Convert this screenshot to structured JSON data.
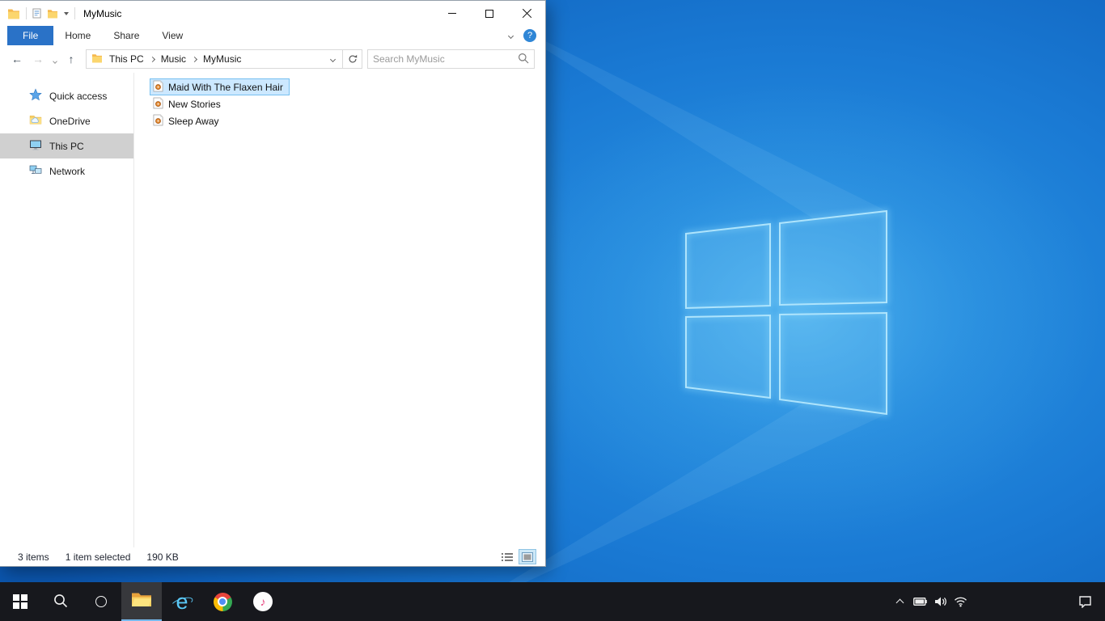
{
  "window": {
    "title": "MyMusic",
    "ribbon": {
      "tabs": [
        {
          "label": "File",
          "active": true
        },
        {
          "label": "Home",
          "active": false
        },
        {
          "label": "Share",
          "active": false
        },
        {
          "label": "View",
          "active": false
        }
      ],
      "help_label": "?"
    },
    "navigation": {
      "breadcrumb": [
        "This PC",
        "Music",
        "MyMusic"
      ],
      "search_placeholder": "Search MyMusic"
    },
    "sidebar": {
      "items": [
        {
          "label": "Quick access",
          "icon": "star-icon",
          "selected": false
        },
        {
          "label": "OneDrive",
          "icon": "onedrive-folder-icon",
          "selected": false
        },
        {
          "label": "This PC",
          "icon": "computer-icon",
          "selected": true
        },
        {
          "label": "Network",
          "icon": "network-icon",
          "selected": false
        }
      ]
    },
    "files": {
      "items": [
        {
          "name": "Maid With The Flaxen Hair",
          "icon": "music-file-icon",
          "selected": true
        },
        {
          "name": "New Stories",
          "icon": "music-file-icon",
          "selected": false
        },
        {
          "name": "Sleep Away",
          "icon": "music-file-icon",
          "selected": false
        }
      ]
    },
    "status": {
      "count": "3 items",
      "selection": "1 item selected",
      "size": "190 KB"
    }
  },
  "icons": {
    "back_arrow": "←",
    "forward_arrow": "→",
    "up_arrow": "↑"
  },
  "taskbar": {
    "buttons": [
      "start",
      "search",
      "cortana",
      "file-explorer",
      "internet-explorer",
      "chrome",
      "itunes"
    ],
    "active_app": "file-explorer",
    "ie_glyph": "e",
    "itunes_glyph": "♪",
    "tray": [
      "hidden-icons",
      "battery",
      "volume",
      "network",
      "action-center"
    ]
  },
  "colors": {
    "file_tab_blue": "#2a72c7",
    "selection_bg": "#cce8ff",
    "selection_border": "#77c0f0",
    "sidebar_selected_bg": "#d0d0d0",
    "desktop_blue": "#1a7ad4",
    "taskbar_bg": "#17181d"
  }
}
